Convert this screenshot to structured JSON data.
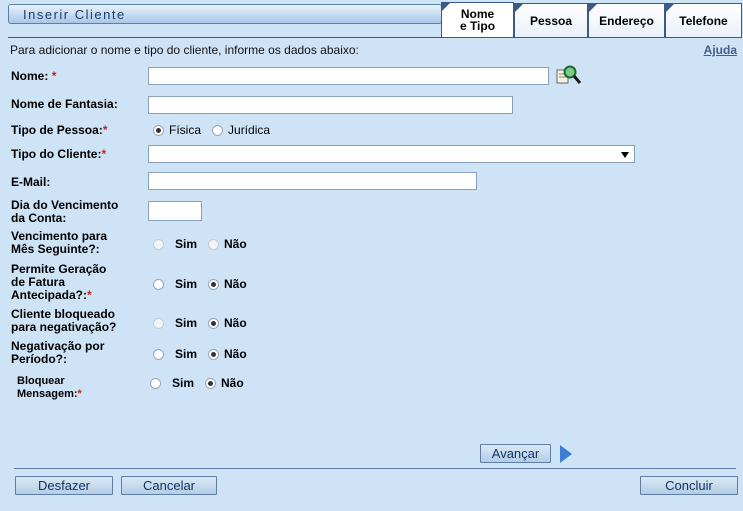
{
  "header": {
    "title": "Inserir Cliente",
    "tabs": [
      {
        "label": "Nome\ne Tipo",
        "active": true
      },
      {
        "label": "Pessoa",
        "active": false
      },
      {
        "label": "Endereço",
        "active": false
      },
      {
        "label": "Telefone",
        "active": false
      }
    ]
  },
  "intro": "Para adicionar o nome e tipo do cliente, informe os dados abaixo:",
  "help_link": "Ajuda",
  "fields": {
    "nome": {
      "label": "Nome:",
      "required": "*",
      "value": ""
    },
    "nome_fantasia": {
      "label": "Nome de Fantasia:",
      "value": ""
    },
    "tipo_pessoa": {
      "label": "Tipo de Pessoa:",
      "required": "*",
      "options": [
        "Física",
        "Jurídica"
      ],
      "selected": "Física"
    },
    "tipo_cliente": {
      "label": "Tipo do Cliente:",
      "required": "*",
      "value": ""
    },
    "email": {
      "label": "E-Mail:",
      "value": ""
    },
    "dia_vencimento": {
      "label_line1": "Dia do Vencimento",
      "label_line2": "da Conta:",
      "value": ""
    },
    "vencimento_mes_seguinte": {
      "label_line1": "Vencimento para",
      "label_line2": "Mês Seguinte?:",
      "options": [
        "Sim",
        "Não"
      ],
      "selected": ""
    },
    "fatura_antecipada": {
      "label_line1": "Permite Geração",
      "label_line2": "de Fatura",
      "label_line3": "Antecipada?:",
      "required": "*",
      "options": [
        "Sim",
        "Não"
      ],
      "selected": "Não"
    },
    "bloqueado_negativacao": {
      "label_line1": "Cliente bloqueado",
      "label_line2": "para negativação?",
      "options": [
        "Sim",
        "Não"
      ],
      "selected": "Não"
    },
    "negativacao_periodo": {
      "label_line1": "Negativação por",
      "label_line2": "Período?:",
      "options": [
        "Sim",
        "Não"
      ],
      "selected": "Não"
    },
    "bloquear_mensagem": {
      "label_line1": "Bloquear",
      "label_line2": "Mensagem:",
      "required": "*",
      "options": [
        "Sim",
        "Não"
      ],
      "selected": "Não"
    }
  },
  "buttons": {
    "avancar": "Avançar",
    "desfazer": "Desfazer",
    "cancelar": "Cancelar",
    "concluir": "Concluir"
  },
  "icons": {
    "search": "search-icon"
  }
}
